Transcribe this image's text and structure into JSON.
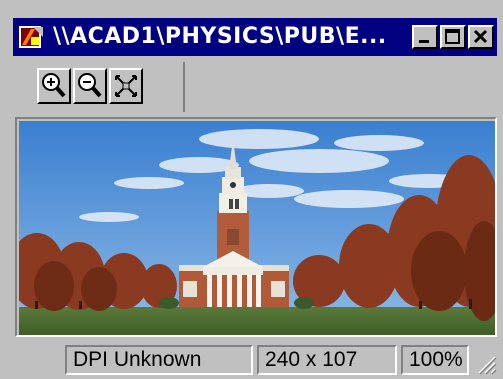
{
  "window": {
    "title": "\\\\ACAD1\\PHYSICS\\PUB\\E...",
    "icon": "app-icon",
    "controls": [
      "minimize-icon",
      "maximize-icon",
      "close-icon"
    ]
  },
  "toolbar": {
    "buttons": [
      {
        "name": "zoom-in",
        "icon": "zoom-in-icon"
      },
      {
        "name": "zoom-out",
        "icon": "zoom-out-icon"
      },
      {
        "name": "fit",
        "icon": "fit-to-window-icon"
      }
    ]
  },
  "image": {
    "subject": "campus-building-photo"
  },
  "status": {
    "dpi": "DPI Unknown",
    "dimensions": "240 x 107",
    "zoom": "100%"
  },
  "colors": {
    "titlebar": "#000080",
    "face": "#c0c0c0"
  }
}
